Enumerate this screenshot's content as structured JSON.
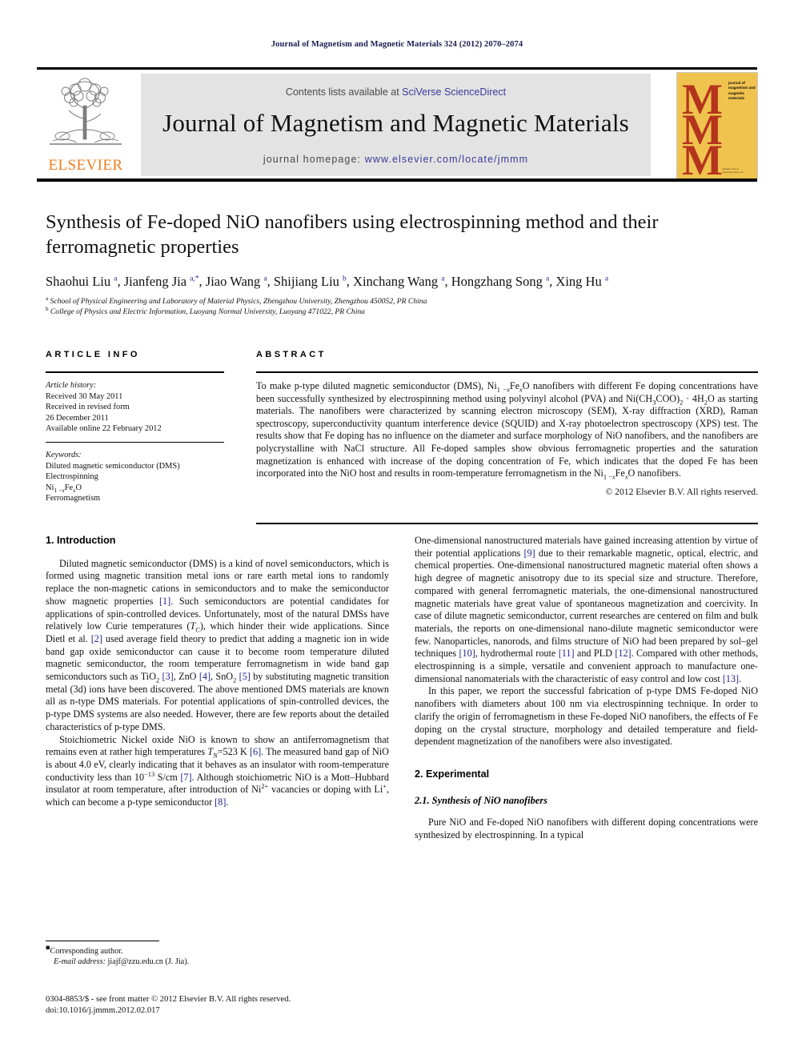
{
  "running_head": "Journal of Magnetism and Magnetic Materials 324 (2012) 2070–2074",
  "masthead": {
    "elsevier_wordmark": "ELSEVIER",
    "contents_prefix": "Contents lists available at ",
    "contents_link": "SciVerse ScienceDirect",
    "journal_title": "Journal of Magnetism and Magnetic Materials",
    "homepage_prefix": "journal homepage: ",
    "homepage_link": "www.elsevier.com/locate/jmmm",
    "cover": {
      "letter": "M",
      "title_lines": "journal of magnetism and magnetic materials",
      "foot_text": "available online at www.sciencedirect.com"
    },
    "colors": {
      "elsevier_orange": "#f07c1e",
      "link_blue": "#3b3b9e",
      "banner_gray": "#e3e3e3",
      "cover_yellow": "#f0c34f",
      "cover_red": "#b4341d"
    }
  },
  "title": "Synthesis of Fe-doped NiO nanofibers using electrospinning method and their ferromagnetic properties",
  "authors_html": "Shaohui Liu <sup>a</sup>, Jianfeng Jia <sup>a,*</sup>, Jiao Wang <sup>a</sup>, Shijiang Liu <sup>b</sup>, Xinchang Wang <sup>a</sup>, Hongzhang Song <sup>a</sup>, Xing Hu <sup>a</sup>",
  "affiliations": [
    "School of Physical Engineering and Laboratory of Material Physics, Zhengzhou University, Zhengzhou 450052, PR China",
    "College of Physics and Electric Information, Luoyang Normal University, Luoyang 471022, PR China"
  ],
  "affiliation_marks": [
    "a",
    "b"
  ],
  "article_info": {
    "heading": "ARTICLE INFO",
    "history_label": "Article history:",
    "history": [
      "Received 30 May 2011",
      "Received in revised form",
      "26 December 2011",
      "Available online 22 February 2012"
    ],
    "keywords_label": "Keywords:",
    "keywords_html": [
      "Diluted magnetic semiconductor (DMS)",
      "Electrospinning",
      "Ni<sub>1 −<i>x</i></sub>Fe<sub><i>x</i></sub>O",
      "Ferromagnetism"
    ]
  },
  "abstract": {
    "heading": "ABSTRACT",
    "body_html": "To make p-type diluted magnetic semiconductor (DMS), Ni<sub>1 −<i>x</i></sub>Fe<sub><i>x</i></sub>O nanofibers with different Fe doping concentrations have been successfully synthesized by electrospinning method using polyvinyl alcohol (PVA) and Ni(CH<sub>3</sub>COO)<sub>2</sub> · 4H<sub>2</sub>O as starting materials. The nanofibers were characterized by scanning electron microscopy (SEM), X-ray diffraction (XRD), Raman spectroscopy, superconductivity quantum interference device (SQUID) and X-ray photoelectron spectroscopy (XPS) test. The results show that Fe doping has no influence on the diameter and surface morphology of NiO nanofibers, and the nanofibers are polycrystalline with NaCl structure. All Fe-doped samples show obvious ferromagnetic properties and the saturation magnetization is enhanced with increase of the doping concentration of Fe, which indicates that the doped Fe has been incorporated into the NiO host and results in room-temperature ferromagnetism in the Ni<sub>1 −<i>x</i></sub>Fe<sub><i>x</i></sub>O nanofibers.",
    "copyright": "© 2012 Elsevier B.V. All rights reserved."
  },
  "sections": {
    "introduction_heading": "1.  Introduction",
    "experimental_heading": "2.  Experimental",
    "experimental_sub_heading": "2.1.  Synthesis of NiO nanofibers"
  },
  "body": {
    "left": [
      "Diluted magnetic semiconductor (DMS) is a kind of novel semiconductors, which is formed using magnetic transition metal ions or rare earth metal ions to randomly replace the non-magnetic cations in semiconductors and to make the semiconductor show magnetic properties <span class=\"ref\">[1]</span>. Such semiconductors are potential candidates for applications of spin-controlled devices. Unfortunately, most of the natural DMSs have relatively low Curie temperatures (<i>T<sub>C</sub></i>), which hinder their wide applications. Since Dietl et al. <span class=\"ref\">[2]</span> used average field theory to predict that adding a magnetic ion in wide band gap oxide semiconductor can cause it to become room temperature diluted magnetic semiconductor, the room temperature ferromagnetism in wide band gap semiconductors such as TiO<sub>2</sub> <span class=\"ref\">[3]</span>, ZnO <span class=\"ref\">[4]</span>, SnO<sub>2</sub> <span class=\"ref\">[5]</span> by substituting magnetic transition metal (3d) ions have been discovered. The above mentioned DMS materials are known all as n-type DMS materials. For potential applications of spin-controlled devices, the p-type DMS systems are also needed. However, there are few reports about the detailed characteristics of p-type DMS.",
      "Stoichiometric Nickel oxide NiO is known to show an antiferromagnetism that remains even at rather high temperatures <i>T<sub>N</sub></i>=523 K <span class=\"ref\">[6]</span>. The measured band gap of NiO is about 4.0 eV, clearly indicating that it behaves as an insulator with room-temperature conductivity less than 10<sup>−13</sup> S/cm <span class=\"ref\">[7]</span>. Although stoichiometric NiO is a Mott–Hubbard insulator at room temperature, after introduction of Ni<sup>2+</sup> vacancies or doping with Li<sup>+</sup>, which can become a p-type semiconductor <span class=\"ref\">[8]</span>."
    ],
    "right": [
      "One-dimensional nanostructured materials have gained increasing attention by virtue of their potential applications <span class=\"ref\">[9]</span> due to their remarkable magnetic, optical, electric, and chemical properties. One-dimensional nanostructured magnetic material often shows a high degree of magnetic anisotropy due to its special size and structure. Therefore, compared with general ferromagnetic materials, the one-dimensional nanostructured magnetic materials have great value of spontaneous magnetization and coercivity. In case of dilute magnetic semiconductor, current researches are centered on film and bulk materials, the reports on one-dimensional nano-dilute magnetic semiconductor were few. Nanoparticles, nanorods, and films structure of NiO had been prepared by sol–gel techniques <span class=\"ref\">[10]</span>, hydrothermal route <span class=\"ref\">[11]</span> and PLD <span class=\"ref\">[12]</span>. Compared with other methods, electrospinning is a simple, versatile and convenient approach to manufacture one-dimensional nanomaterials with the characteristic of easy control and low cost <span class=\"ref\">[13]</span>.",
      "In this paper, we report the successful fabrication of p-type DMS Fe-doped NiO nanofibers with diameters about 100 nm via electrospinning technique. In order to clarify the origin of ferromagnetism in these Fe-doped NiO nanofibers, the effects of Fe doping on the crystal structure, morphology and detailed temperature and field-dependent magnetization of the nanofibers were also investigated.",
      "Pure NiO and Fe-doped NiO nanofibers with different doping concentrations were synthesized by electrospinning. In a typical"
    ]
  },
  "footnote": {
    "corresponding": "Corresponding author.",
    "email_label": "E-mail address:",
    "email": "jiajf@zzu.edu.cn (J. Jia)."
  },
  "imprint": {
    "line1": "0304-8853/$ - see front matter © 2012 Elsevier B.V. All rights reserved.",
    "line2": "doi:10.1016/j.jmmm.2012.02.017"
  }
}
